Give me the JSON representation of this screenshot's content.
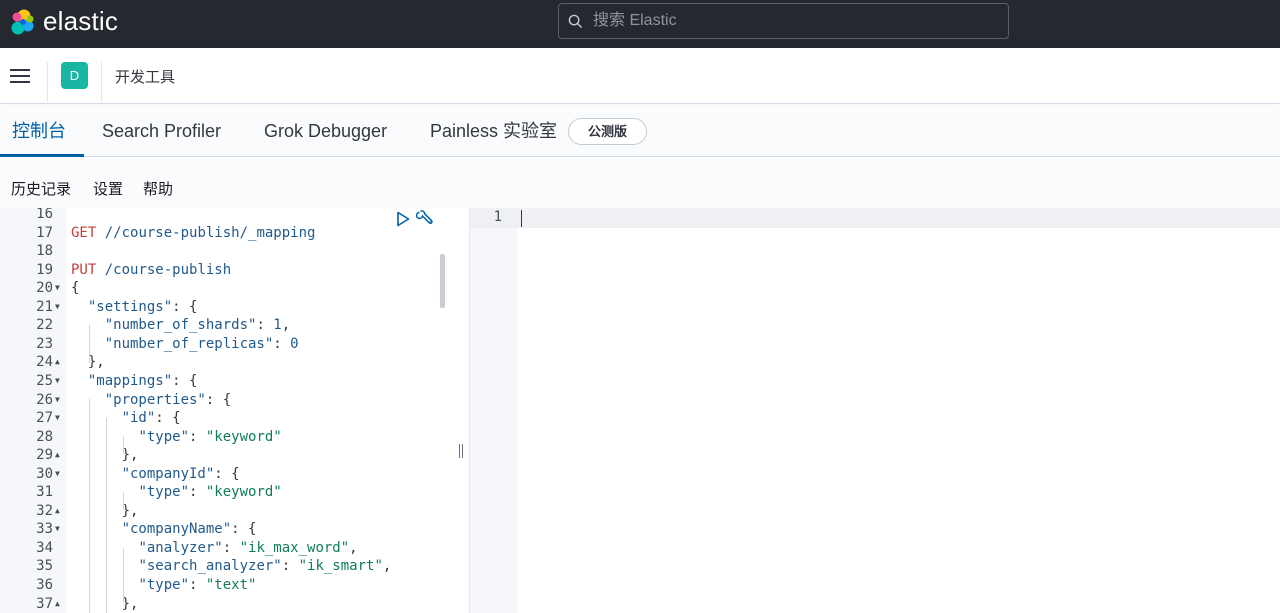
{
  "header": {
    "logo_text": "elastic",
    "search_placeholder": "搜索 Elastic"
  },
  "appbar": {
    "avatar_initial": "D",
    "title": "开发工具"
  },
  "tabs": [
    {
      "label": "控制台",
      "active": true
    },
    {
      "label": "Search Profiler",
      "active": false
    },
    {
      "label": "Grok Debugger",
      "active": false
    },
    {
      "label": "Painless 实验室",
      "active": false
    }
  ],
  "beta_badge": "公测版",
  "submenu": {
    "history": "历史记录",
    "settings": "设置",
    "help": "帮助"
  },
  "editor": {
    "lines": [
      {
        "n": "16",
        "fold": "",
        "text": ""
      },
      {
        "n": "17",
        "fold": "",
        "text": "GET //course-publish/_mapping"
      },
      {
        "n": "18",
        "fold": "",
        "text": ""
      },
      {
        "n": "19",
        "fold": "",
        "text": "PUT /course-publish"
      },
      {
        "n": "20",
        "fold": "down",
        "text": "{"
      },
      {
        "n": "21",
        "fold": "down",
        "text": "  \"settings\": {"
      },
      {
        "n": "22",
        "fold": "",
        "text": "    \"number_of_shards\": 1,"
      },
      {
        "n": "23",
        "fold": "",
        "text": "    \"number_of_replicas\": 0"
      },
      {
        "n": "24",
        "fold": "up",
        "text": "  },"
      },
      {
        "n": "25",
        "fold": "down",
        "text": "  \"mappings\": {"
      },
      {
        "n": "26",
        "fold": "down",
        "text": "    \"properties\": {"
      },
      {
        "n": "27",
        "fold": "down",
        "text": "      \"id\": {"
      },
      {
        "n": "28",
        "fold": "",
        "text": "        \"type\": \"keyword\""
      },
      {
        "n": "29",
        "fold": "up",
        "text": "      },"
      },
      {
        "n": "30",
        "fold": "down",
        "text": "      \"companyId\": {"
      },
      {
        "n": "31",
        "fold": "",
        "text": "        \"type\": \"keyword\""
      },
      {
        "n": "32",
        "fold": "up",
        "text": "      },"
      },
      {
        "n": "33",
        "fold": "down",
        "text": "      \"companyName\": {"
      },
      {
        "n": "34",
        "fold": "",
        "text": "        \"analyzer\": \"ik_max_word\","
      },
      {
        "n": "35",
        "fold": "",
        "text": "        \"search_analyzer\": \"ik_smart\","
      },
      {
        "n": "36",
        "fold": "",
        "text": "        \"type\": \"text\""
      },
      {
        "n": "37",
        "fold": "up",
        "text": "      },"
      }
    ]
  },
  "output": {
    "line_number": "1"
  },
  "colors": {
    "header_bg": "#25282f",
    "accent": "#0061a6",
    "avatar_bg": "#1bb5a3",
    "method": "#c43d3d",
    "string": "#117d55",
    "key": "#225a8c"
  }
}
